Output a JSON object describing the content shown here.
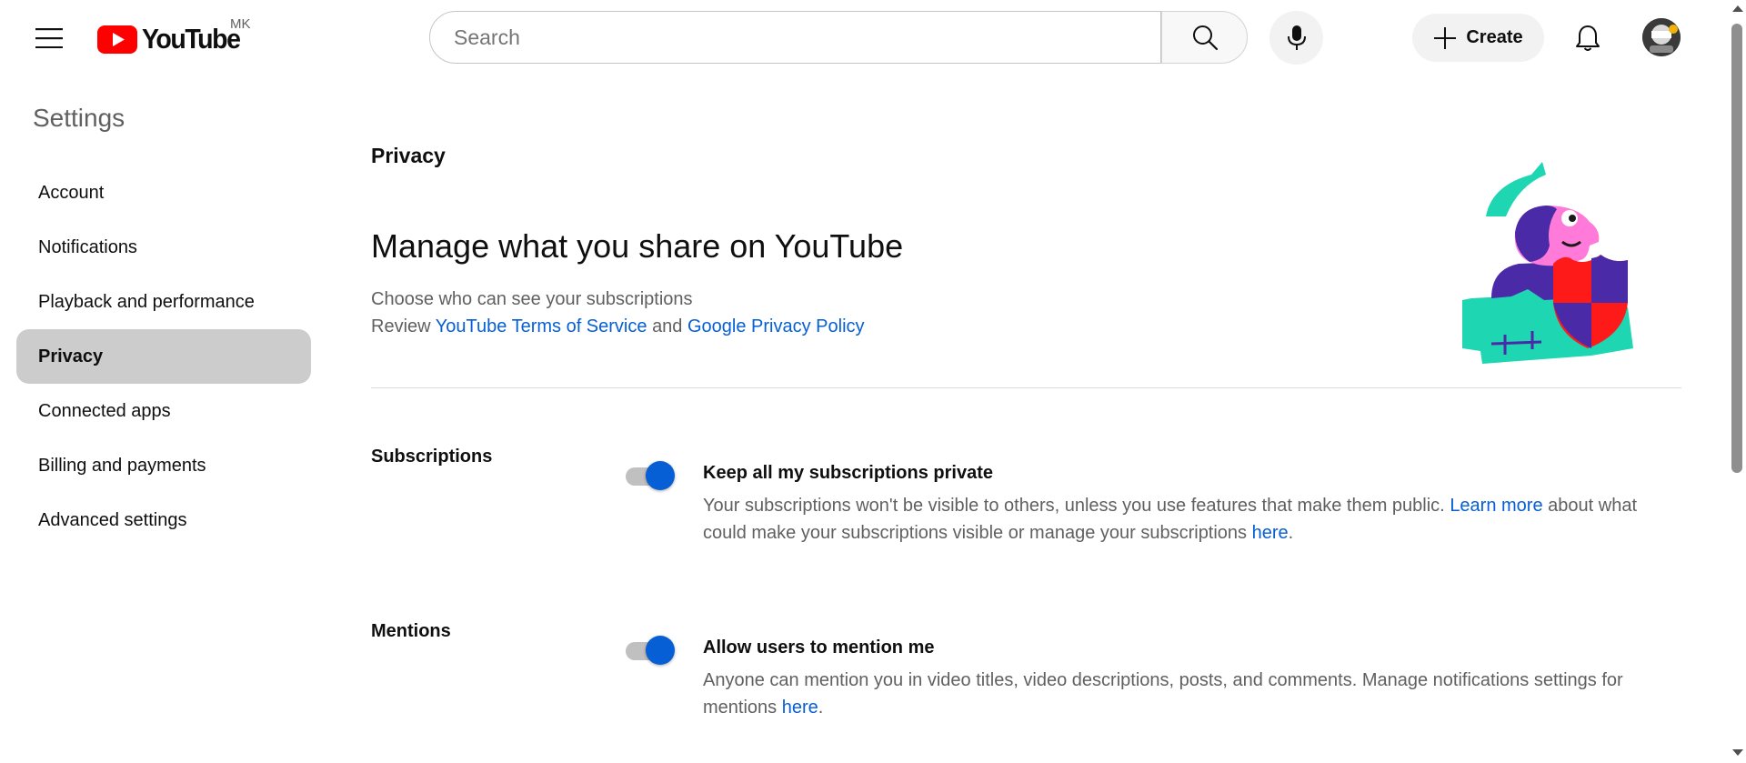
{
  "header": {
    "logo_text": "YouTube",
    "country_code": "MK",
    "search_placeholder": "Search",
    "create_label": "Create"
  },
  "sidebar": {
    "title": "Settings",
    "items": [
      {
        "label": "Account"
      },
      {
        "label": "Notifications"
      },
      {
        "label": "Playback and performance"
      },
      {
        "label": "Privacy",
        "active": true
      },
      {
        "label": "Connected apps"
      },
      {
        "label": "Billing and payments"
      },
      {
        "label": "Advanced settings"
      }
    ]
  },
  "main": {
    "section": "Privacy",
    "heading": "Manage what you share on YouTube",
    "subtitle": "Choose who can see your subscriptions",
    "review_prefix": "Review",
    "terms_link": "YouTube Terms of Service",
    "and_text": "and",
    "policy_link": "Google Privacy Policy",
    "settings": [
      {
        "label": "Subscriptions",
        "toggle_on": true,
        "title": "Keep all my subscriptions private",
        "desc_part1": "Your subscriptions won't be visible to others, unless you use features that make them public.",
        "learn_more": "Learn more",
        "desc_part2": "about what could make your subscriptions visible or manage your subscriptions",
        "here": "here",
        "desc_end": "."
      },
      {
        "label": "Mentions",
        "toggle_on": true,
        "title": "Allow users to mention me",
        "desc_part1": "Anyone can mention you in video titles, video descriptions, posts, and comments. Manage notifications settings for mentions",
        "here": "here",
        "desc_end": "."
      }
    ]
  },
  "colors": {
    "accent": "#065fd4",
    "youtube_red": "#ff0000",
    "active_nav_bg": "#cccccc",
    "muted_text": "#606060"
  },
  "icons": [
    "hamburger-menu-icon",
    "youtube-play-icon",
    "search-icon",
    "microphone-icon",
    "plus-icon",
    "bell-icon",
    "avatar-image",
    "privacy-illustration"
  ]
}
